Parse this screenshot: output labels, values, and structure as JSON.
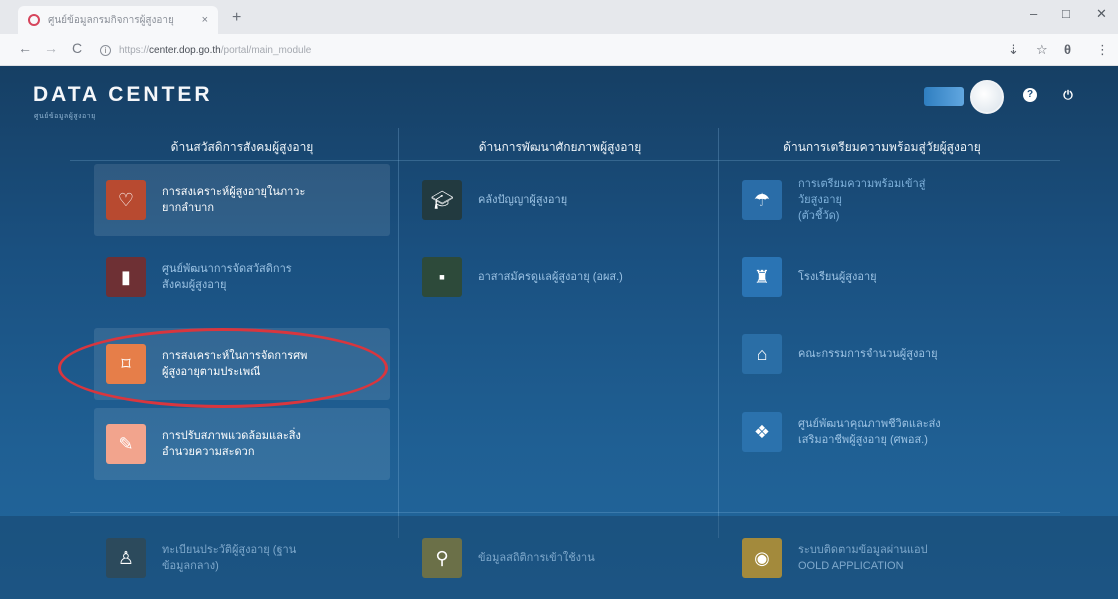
{
  "browser": {
    "tab_title": "ศูนย์ข้อมูลกรมกิจการผู้สูงอายุ",
    "tab_close": "×",
    "new_tab": "+",
    "url_dim_prefix": "https://",
    "url_host": "center.dop.go.th",
    "url_path": "/portal/main_module",
    "controls": {
      "minimize": "–",
      "maximize": "□",
      "close": "✕"
    },
    "nav": {
      "back": "←",
      "forward": "→",
      "reload": "C"
    },
    "toolbar_icons": {
      "download": "⇣",
      "star": "☆",
      "account": "θ",
      "menu": "⋮"
    }
  },
  "app": {
    "title": "DATA CENTER",
    "subtitle": "ศูนย์ข้อมูลผู้สูงอายุ",
    "header_icons": {
      "help": "?",
      "power": "⏻"
    },
    "columns": [
      {
        "title": "ด้านสวัสดิการสังคมผู้สูงอายุ"
      },
      {
        "title": "ด้านการพัฒนาศักยภาพผู้สูงอายุ"
      },
      {
        "title": "ด้านการเตรียมความพร้อมสู่วัยผู้สูงอายุ"
      }
    ],
    "cards": {
      "c1_1": {
        "line1": "การสงเคราะห์ผู้สูงอายุในภาวะ",
        "line2": "ยากลำบาก",
        "tile_color": "#b84a30",
        "icon": "heart-icon"
      },
      "c1_2": {
        "line1": "ศูนย์พัฒนาการจัดสวัสดิการ",
        "line2": "สังคมผู้สูงอายุ",
        "tile_color": "#6e3034",
        "icon": "building-icon"
      },
      "c1_3": {
        "line1": "การสงเคราะห์ในการจัดการศพ",
        "line2": "ผู้สูงอายุตามประเพณี",
        "tile_color": "#e67e49",
        "icon": "bookmark-icon"
      },
      "c1_4": {
        "line1": "การปรับสภาพแวดล้อมและสิ่ง",
        "line2": "อำนวยความสะดวก",
        "tile_color": "#f2a48d",
        "icon": "wrench-icon"
      },
      "c2_1": {
        "line1": "คลังปัญญาผู้สูงอายุ",
        "line2": "",
        "tile_color": "#223a40",
        "icon": "graduation-cap-icon"
      },
      "c2_2": {
        "line1": "อาสาสมัครดูแลผู้สูงอายุ (อผส.)",
        "line2": "",
        "tile_color": "#2d4a3a",
        "icon": "badge-icon"
      },
      "c3_1": {
        "line1": "การเตรียมความพร้อมเข้าสู่",
        "line2": "วัยสูงอายุ",
        "line3": "(ตัวชี้วัด)",
        "tile_color": "#2a6da8",
        "icon": "umbrella-icon"
      },
      "c3_2": {
        "line1": "โรงเรียนผู้สูงอายุ",
        "line2": "",
        "tile_color": "#2a74b4",
        "icon": "school-icon"
      },
      "c3_3": {
        "line1": "คณะกรรมการจำนวนผู้สูงอายุ",
        "line2": "",
        "tile_color": "#2a6ea6",
        "icon": "home-icon"
      },
      "c3_4": {
        "line1": "ศูนย์พัฒนาคุณภาพชีวิตและส่ง",
        "line2": "เสริมอาชีพผู้สูงอายุ (ศพอส.)",
        "tile_color": "#2b72ad",
        "icon": "people-icon"
      }
    },
    "bottom": {
      "b1": {
        "line1": "ทะเบียนประวัติผู้สูงอายุ (ฐาน",
        "line2": "ข้อมูลกลาง)",
        "tile_color": "#2c4a5c",
        "icon": "person-icon"
      },
      "b2": {
        "line1": "ข้อมูลสถิติการเข้าใช้งาน",
        "line2": "",
        "tile_color": "#6b7048",
        "icon": "search-icon"
      },
      "b3": {
        "line1": "ระบบติดตามข้อมูลผ่านแอป",
        "line2": "OOLD APPLICATION",
        "tile_color": "#a38a3c",
        "icon": "app-icon"
      }
    }
  }
}
